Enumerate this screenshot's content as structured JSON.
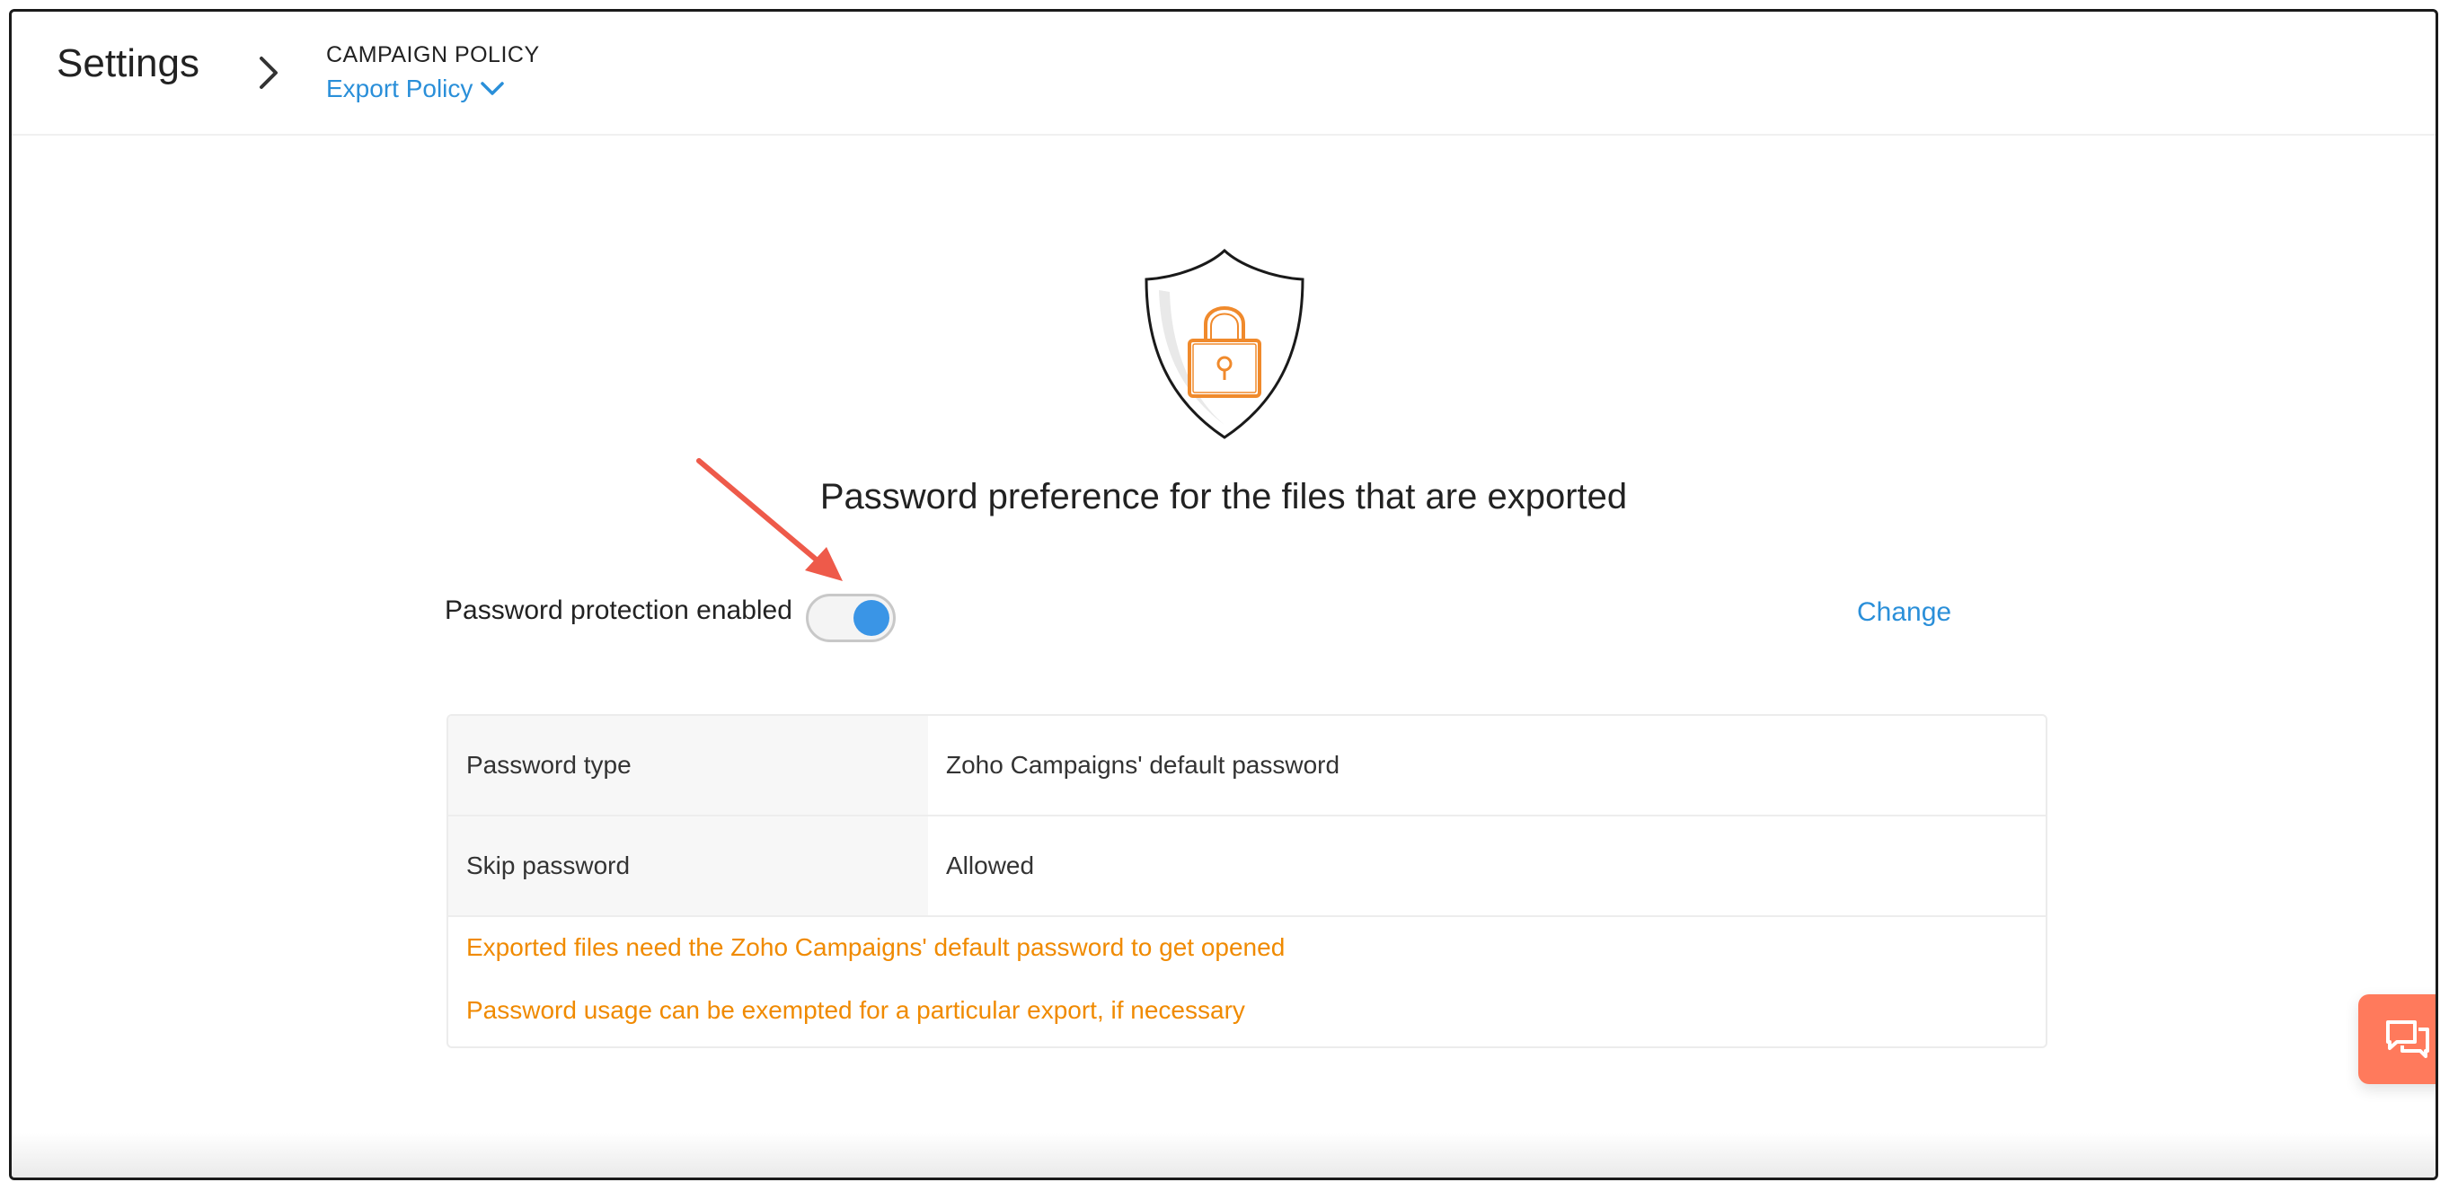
{
  "header": {
    "title": "Settings",
    "section": "CAMPAIGN POLICY",
    "current_page": "Export Policy"
  },
  "main": {
    "heading": "Password preference for the files that are exported",
    "toggle_label": "Password protection enabled",
    "toggle_on": true,
    "change_label": "Change",
    "table": {
      "rows": [
        {
          "key": "Password type",
          "value": "Zoho Campaigns' default password"
        },
        {
          "key": "Skip password",
          "value": "Allowed"
        }
      ],
      "notes": [
        "Exported files need the Zoho Campaigns' default password to get opened",
        "Password usage can be exempted for a particular export, if necessary"
      ]
    }
  },
  "icons": {
    "breadcrumb_separator": "chevron-right-icon",
    "dropdown": "chevron-down-icon",
    "illustration": "shield-lock-icon",
    "chat": "chat-icon"
  },
  "colors": {
    "accent_blue": "#2a8fd9",
    "toggle_blue": "#3a95e6",
    "note_orange": "#f08a00",
    "lock_orange": "#f08a2c",
    "chat_button": "#ff7a5c",
    "annotation_red": "#ee5a4a"
  }
}
